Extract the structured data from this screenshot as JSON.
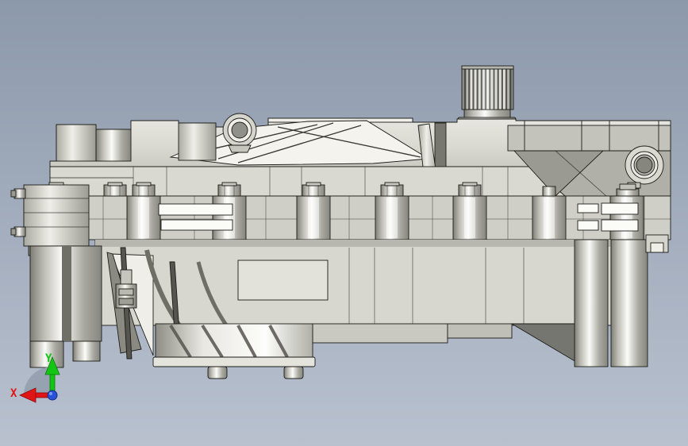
{
  "viewport": {
    "type": "cad-3d-shaded-view",
    "description": "Side orthographic shaded-with-edges view of a gearbox transmission housing model",
    "background": {
      "top": "#8c99ab",
      "bottom": "#b9c1cf"
    }
  },
  "model": {
    "name": "gearbox-housing",
    "edge_color": "#1c1c18",
    "face_colors": {
      "light": "#e9e8e2",
      "mid": "#d6d5ce",
      "dark": "#a8a7a0",
      "shadow": "#77766f",
      "highlight": "#fbfbf8"
    }
  },
  "triad": {
    "x": {
      "label": "X",
      "color": "#e01616"
    },
    "y": {
      "label": "Y",
      "color": "#14c614"
    },
    "z": {
      "color": "#2a52d8"
    }
  }
}
